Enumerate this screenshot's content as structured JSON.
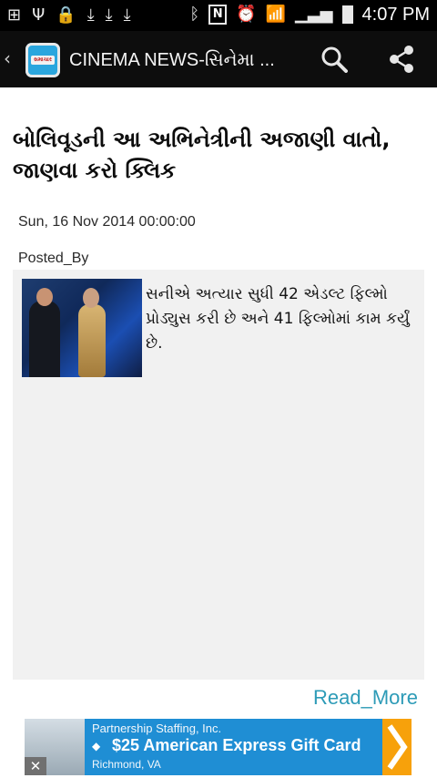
{
  "status_bar": {
    "time": "4:07 PM",
    "icons": [
      "add-box-icon",
      "usb-icon",
      "lock-warning-icon",
      "download-icon",
      "download-icon",
      "download-icon",
      "bluetooth-icon",
      "nfc-icon",
      "alarm-icon",
      "wifi-icon",
      "signal-icon",
      "battery-charging-icon"
    ],
    "nfc_letter": "N"
  },
  "action_bar": {
    "back_glyph": "‹",
    "title": "CINEMA  NEWS-સિનેમા ...",
    "app_icon_text": "સમાચાર"
  },
  "article": {
    "headline": "બોલિવૂડની આ અભિનેત્રીની અજાણી વાતો, જાણવા કરો ક્લિક",
    "date": "Sun, 16 Nov 2014 00:00:00",
    "posted_by": "Posted_By",
    "summary": "સનીએ અત્યાર સુધી 42 એડલ્ટ ફિલ્મો પ્રોડ્યુસ કરી છે અને 41 ફિલ્મોમાં કામ કર્યું છે.",
    "read_more": "Read_More"
  },
  "ad": {
    "line1": "Partnership Staffing, Inc.",
    "line2": "$25 American Express Gift Card",
    "line3": "Richmond, VA",
    "tag_glyph": "◆",
    "close_glyph": "✕",
    "colors": {
      "background": "#1f8ed4",
      "arrow": "#f7a10b"
    }
  },
  "colors": {
    "status_bar": "#000000",
    "action_bar": "#0d0d0d",
    "read_more": "#2d9bb7",
    "story_background": "#f1f1f1"
  }
}
